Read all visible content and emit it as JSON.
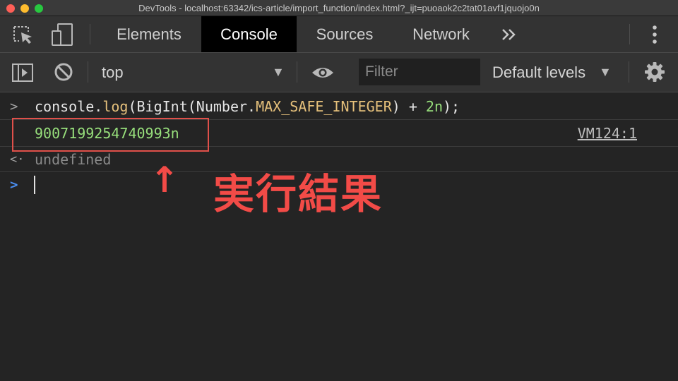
{
  "window": {
    "title": "DevTools - localhost:63342/ics-article/import_function/index.html?_ijt=puoaok2c2tat01avf1jquojo0n"
  },
  "tabs": [
    {
      "label": "Elements",
      "active": false
    },
    {
      "label": "Console",
      "active": true
    },
    {
      "label": "Sources",
      "active": false
    },
    {
      "label": "Network",
      "active": false
    }
  ],
  "tabs_more_icon": "double-chevron-icon",
  "toolbar": {
    "context": "top",
    "filter_placeholder": "Filter",
    "levels": "Default levels"
  },
  "console": {
    "input": {
      "p1": "console.",
      "p2": "log",
      "p3": "(BigInt(Number.",
      "p4": "MAX_SAFE_INTEGER",
      "p5": ") + ",
      "p6": "2n",
      "p7": ");"
    },
    "output_value": "9007199254740993n",
    "source_link": "VM124:1",
    "return_value": "undefined"
  },
  "annotation": {
    "arrow": "↑",
    "text": "実行結果"
  },
  "colors": {
    "accent": "#f24b47",
    "number": "#98e07c",
    "property": "#e5c07b",
    "prompt": "#4a8ef0"
  }
}
